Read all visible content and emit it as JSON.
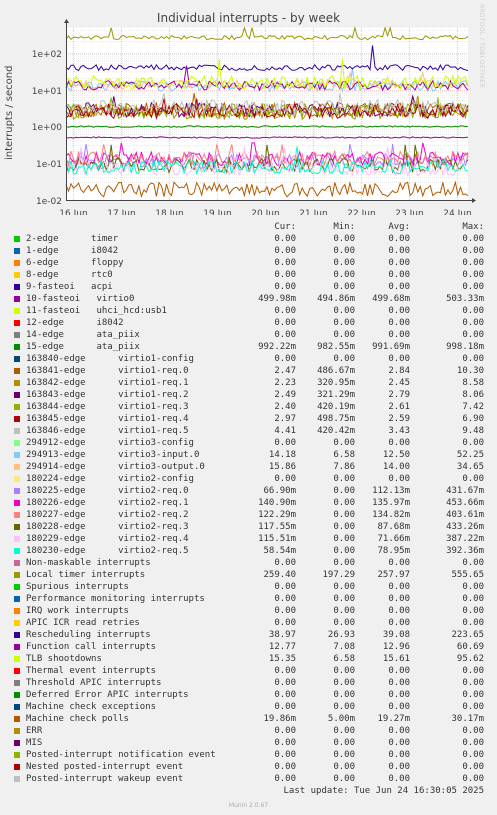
{
  "chart_data": {
    "type": "line",
    "title": "Individual interrupts - by week",
    "ylabel": "interrupts / second",
    "yscale": "log",
    "ylim": [
      0.01,
      500
    ],
    "yticks": [
      "1e+02",
      "1e+01",
      "1e+00",
      "1e-01",
      "1e-02"
    ],
    "xticks": [
      "16 Jun",
      "17 Jun",
      "18 Jun",
      "19 Jun",
      "20 Jun",
      "21 Jun",
      "22 Jun",
      "23 Jun",
      "24 Jun"
    ],
    "grid": true,
    "side_label": "RRDTOOL / TOBI OETIKER",
    "headers": [
      "Cur:",
      "Min:",
      "Avg:",
      "Max:"
    ],
    "series": [
      {
        "name": "2-edge      timer",
        "color": "#00cc00",
        "cur": "0.00",
        "min": "0.00",
        "avg": "0.00",
        "max": "0.00"
      },
      {
        "name": "1-edge      i8042",
        "color": "#0066b3",
        "cur": "0.00",
        "min": "0.00",
        "avg": "0.00",
        "max": "0.00"
      },
      {
        "name": "6-edge      floppy",
        "color": "#ff8000",
        "cur": "0.00",
        "min": "0.00",
        "avg": "0.00",
        "max": "0.00"
      },
      {
        "name": "8-edge      rtc0",
        "color": "#ffcc00",
        "cur": "0.00",
        "min": "0.00",
        "avg": "0.00",
        "max": "0.00"
      },
      {
        "name": "9-fasteoi   acpi",
        "color": "#330099",
        "cur": "0.00",
        "min": "0.00",
        "avg": "0.00",
        "max": "0.00"
      },
      {
        "name": "10-fasteoi   virtio0",
        "color": "#990099",
        "cur": "499.98m",
        "min": "494.86m",
        "avg": "499.68m",
        "max": "503.33m"
      },
      {
        "name": "11-fasteoi   uhci_hcd:usb1",
        "color": "#ccff00",
        "cur": "0.00",
        "min": "0.00",
        "avg": "0.00",
        "max": "0.00"
      },
      {
        "name": "12-edge      i8042",
        "color": "#ff0000",
        "cur": "0.00",
        "min": "0.00",
        "avg": "0.00",
        "max": "0.00"
      },
      {
        "name": "14-edge      ata_piix",
        "color": "#808080",
        "cur": "0.00",
        "min": "0.00",
        "avg": "0.00",
        "max": "0.00"
      },
      {
        "name": "15-edge      ata_piix",
        "color": "#008f00",
        "cur": "992.22m",
        "min": "982.55m",
        "avg": "991.69m",
        "max": "998.18m"
      },
      {
        "name": "163840-edge      virtio1-config",
        "color": "#00487d",
        "cur": "0.00",
        "min": "0.00",
        "avg": "0.00",
        "max": "0.00"
      },
      {
        "name": "163841-edge      virtio1-req.0",
        "color": "#b35a00",
        "cur": "2.47",
        "min": "486.67m",
        "avg": "2.84",
        "max": "10.30"
      },
      {
        "name": "163842-edge      virtio1-req.1",
        "color": "#b38f00",
        "cur": "2.23",
        "min": "320.95m",
        "avg": "2.45",
        "max": "8.58"
      },
      {
        "name": "163843-edge      virtio1-req.2",
        "color": "#6b006b",
        "cur": "2.49",
        "min": "321.29m",
        "avg": "2.79",
        "max": "8.06"
      },
      {
        "name": "163844-edge      virtio1-req.3",
        "color": "#8fb300",
        "cur": "2.40",
        "min": "420.19m",
        "avg": "2.61",
        "max": "7.42"
      },
      {
        "name": "163845-edge      virtio1-req.4",
        "color": "#b30000",
        "cur": "2.97",
        "min": "498.75m",
        "avg": "2.59",
        "max": "6.90"
      },
      {
        "name": "163846-edge      virtio1-req.5",
        "color": "#bebebe",
        "cur": "4.41",
        "min": "420.42m",
        "avg": "3.43",
        "max": "9.48"
      },
      {
        "name": "294912-edge      virtio3-config",
        "color": "#80ff80",
        "cur": "0.00",
        "min": "0.00",
        "avg": "0.00",
        "max": "0.00"
      },
      {
        "name": "294913-edge      virtio3-input.0",
        "color": "#80c9ff",
        "cur": "14.18",
        "min": "6.58",
        "avg": "12.50",
        "max": "52.25"
      },
      {
        "name": "294914-edge      virtio3-output.0",
        "color": "#ffc080",
        "cur": "15.86",
        "min": "7.86",
        "avg": "14.00",
        "max": "34.65"
      },
      {
        "name": "180224-edge      virtio2-config",
        "color": "#ffe680",
        "cur": "0.00",
        "min": "0.00",
        "avg": "0.00",
        "max": "0.00"
      },
      {
        "name": "180225-edge      virtio2-req.0",
        "color": "#aa80ff",
        "cur": "66.90m",
        "min": "0.00",
        "avg": "112.13m",
        "max": "431.67m"
      },
      {
        "name": "180226-edge      virtio2-req.1",
        "color": "#ee00cc",
        "cur": "140.90m",
        "min": "0.00",
        "avg": "135.97m",
        "max": "453.66m"
      },
      {
        "name": "180227-edge      virtio2-req.2",
        "color": "#ff8080",
        "cur": "122.29m",
        "min": "0.00",
        "avg": "134.82m",
        "max": "403.61m"
      },
      {
        "name": "180228-edge      virtio2-req.3",
        "color": "#666600",
        "cur": "117.55m",
        "min": "0.00",
        "avg": "87.68m",
        "max": "433.26m"
      },
      {
        "name": "180229-edge      virtio2-req.4",
        "color": "#ffbfff",
        "cur": "115.51m",
        "min": "0.00",
        "avg": "71.66m",
        "max": "387.22m"
      },
      {
        "name": "180230-edge      virtio2-req.5",
        "color": "#00ffcc",
        "cur": "58.54m",
        "min": "0.00",
        "avg": "78.95m",
        "max": "392.36m"
      },
      {
        "name": "Non-maskable interrupts",
        "color": "#cc6699",
        "cur": "0.00",
        "min": "0.00",
        "avg": "0.00",
        "max": "0.00"
      },
      {
        "name": "Local timer interrupts",
        "color": "#999900",
        "cur": "259.40",
        "min": "197.29",
        "avg": "257.97",
        "max": "555.65"
      },
      {
        "name": "Spurious interrupts",
        "color": "#00cc00",
        "cur": "0.00",
        "min": "0.00",
        "avg": "0.00",
        "max": "0.00"
      },
      {
        "name": "Performance monitoring interrupts",
        "color": "#0066b3",
        "cur": "0.00",
        "min": "0.00",
        "avg": "0.00",
        "max": "0.00"
      },
      {
        "name": "IRQ work interrupts",
        "color": "#ff8000",
        "cur": "0.00",
        "min": "0.00",
        "avg": "0.00",
        "max": "0.00"
      },
      {
        "name": "APIC ICR read retries",
        "color": "#ffcc00",
        "cur": "0.00",
        "min": "0.00",
        "avg": "0.00",
        "max": "0.00"
      },
      {
        "name": "Rescheduling interrupts",
        "color": "#330099",
        "cur": "38.97",
        "min": "26.93",
        "avg": "39.08",
        "max": "223.65"
      },
      {
        "name": "Function call interrupts",
        "color": "#990099",
        "cur": "12.77",
        "min": "7.08",
        "avg": "12.96",
        "max": "60.69"
      },
      {
        "name": "TLB shootdowns",
        "color": "#ccff00",
        "cur": "15.35",
        "min": "6.58",
        "avg": "15.61",
        "max": "95.62"
      },
      {
        "name": "Thermal event interrupts",
        "color": "#ff0000",
        "cur": "0.00",
        "min": "0.00",
        "avg": "0.00",
        "max": "0.00"
      },
      {
        "name": "Threshold APIC interrupts",
        "color": "#808080",
        "cur": "0.00",
        "min": "0.00",
        "avg": "0.00",
        "max": "0.00"
      },
      {
        "name": "Deferred Error APIC interrupts",
        "color": "#008f00",
        "cur": "0.00",
        "min": "0.00",
        "avg": "0.00",
        "max": "0.00"
      },
      {
        "name": "Machine check exceptions",
        "color": "#00487d",
        "cur": "0.00",
        "min": "0.00",
        "avg": "0.00",
        "max": "0.00"
      },
      {
        "name": "Machine check polls",
        "color": "#b35a00",
        "cur": "19.86m",
        "min": "5.00m",
        "avg": "19.27m",
        "max": "30.17m"
      },
      {
        "name": "ERR",
        "color": "#b38f00",
        "cur": "0.00",
        "min": "0.00",
        "avg": "0.00",
        "max": "0.00"
      },
      {
        "name": "MIS",
        "color": "#6b006b",
        "cur": "0.00",
        "min": "0.00",
        "avg": "0.00",
        "max": "0.00"
      },
      {
        "name": "Posted-interrupt notification event",
        "color": "#8fb300",
        "cur": "0.00",
        "min": "0.00",
        "avg": "0.00",
        "max": "0.00"
      },
      {
        "name": "Nested posted-interrupt event",
        "color": "#b30000",
        "cur": "0.00",
        "min": "0.00",
        "avg": "0.00",
        "max": "0.00"
      },
      {
        "name": "Posted-interrupt wakeup event",
        "color": "#bebebe",
        "cur": "0.00",
        "min": "0.00",
        "avg": "0.00",
        "max": "0.00"
      }
    ]
  },
  "footer": {
    "last_update": "Last update: Tue Jun 24 16:30:05 2025",
    "munin": "Munin 2.0.67"
  }
}
